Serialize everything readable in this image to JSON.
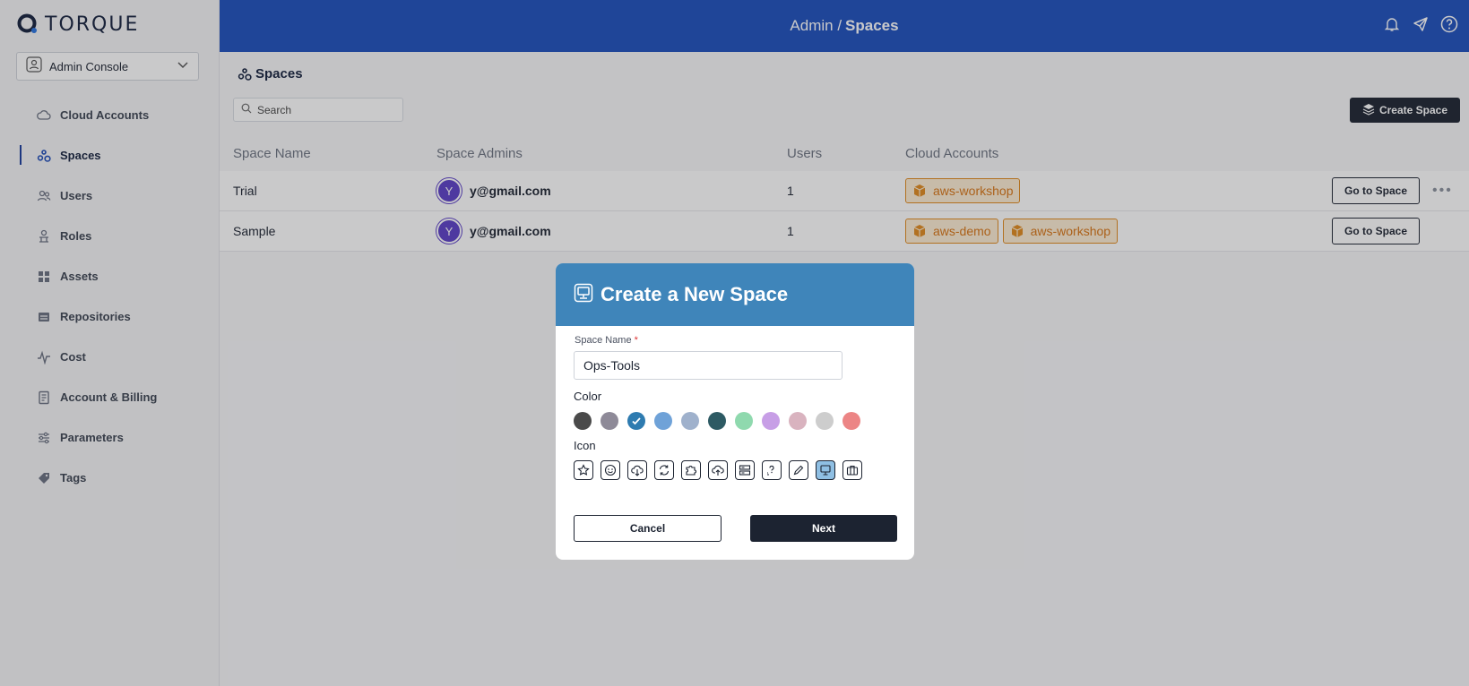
{
  "brand": {
    "name": "TORQUE"
  },
  "console": {
    "label": "Admin Console"
  },
  "nav": [
    {
      "label": "Cloud Accounts",
      "icon": "cloud-icon",
      "active": false
    },
    {
      "label": "Spaces",
      "icon": "spaces-icon",
      "active": true
    },
    {
      "label": "Users",
      "icon": "users-icon",
      "active": false
    },
    {
      "label": "Roles",
      "icon": "roles-icon",
      "active": false
    },
    {
      "label": "Assets",
      "icon": "assets-icon",
      "active": false
    },
    {
      "label": "Repositories",
      "icon": "repositories-icon",
      "active": false
    },
    {
      "label": "Cost",
      "icon": "cost-icon",
      "active": false
    },
    {
      "label": "Account & Billing",
      "icon": "billing-icon",
      "active": false
    },
    {
      "label": "Parameters",
      "icon": "parameters-icon",
      "active": false
    },
    {
      "label": "Tags",
      "icon": "tag-icon",
      "active": false
    }
  ],
  "header": {
    "section": "Admin /",
    "current": "Spaces"
  },
  "page": {
    "title": "Spaces",
    "search_placeholder": "Search",
    "create_label": "Create Space"
  },
  "table": {
    "columns": [
      "Space Name",
      "Space Admins",
      "Users",
      "Cloud Accounts"
    ],
    "rows": [
      {
        "name": "Trial",
        "admin_initial": "Y",
        "admin_email": "y@gmail.com",
        "users": "1",
        "accounts": [
          "aws-workshop"
        ],
        "action": "Go to Space"
      },
      {
        "name": "Sample",
        "admin_initial": "Y",
        "admin_email": "y@gmail.com",
        "users": "1",
        "accounts": [
          "aws-demo",
          "aws-workshop"
        ],
        "action": "Go to Space"
      }
    ]
  },
  "modal": {
    "title": "Create a New Space",
    "name_label": "Space Name",
    "required_mark": "*",
    "name_value": "Ops-Tools",
    "color_label": "Color",
    "icon_label": "Icon",
    "colors": [
      "#4a4a4a",
      "#8e8a98",
      "#2e7bb0",
      "#6fa2d8",
      "#9fb1cc",
      "#2d5a63",
      "#8fd9ae",
      "#c79ee6",
      "#d9b3bf",
      "#cdcdcd",
      "#ec8585"
    ],
    "selected_color_index": 2,
    "icons": [
      "star-icon",
      "face-icon",
      "cloud-download-icon",
      "refresh-icon",
      "puzzle-icon",
      "cloud-upload-icon",
      "server-icon",
      "terminal-icon",
      "pencil-icon",
      "monitor-icon",
      "briefcase-icon"
    ],
    "selected_icon_index": 9,
    "cancel_label": "Cancel",
    "next_label": "Next"
  }
}
